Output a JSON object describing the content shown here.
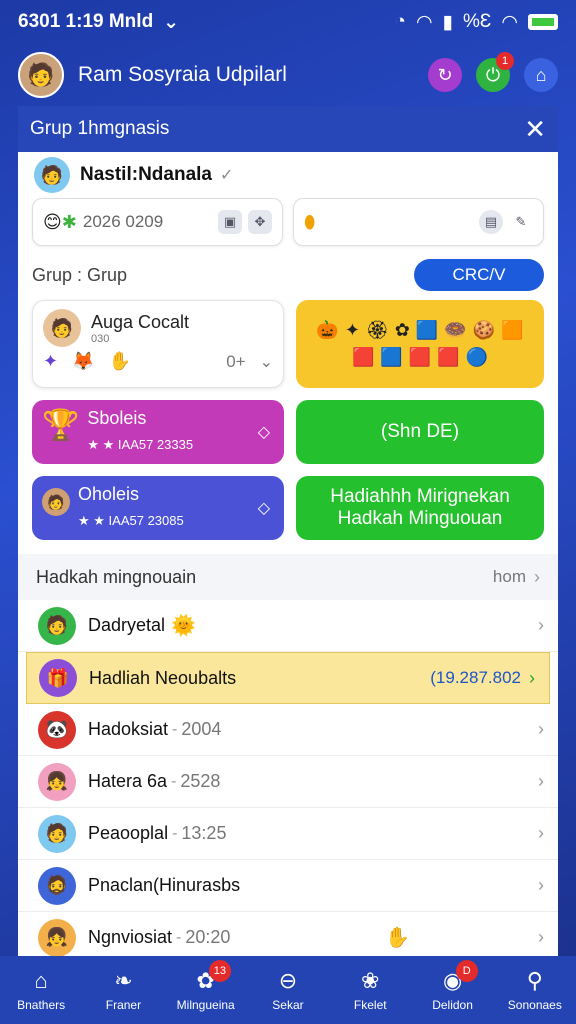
{
  "status": {
    "time": "6301 1:19 Mnld",
    "battery_text": "%Ɛ",
    "chevron": "chevron-down-icon"
  },
  "appbar": {
    "title": "Ram Sosyraia Udpilarl",
    "badge_green": "1"
  },
  "panel": {
    "title": "Grup 1hmgnasis",
    "close": "✕"
  },
  "profile": {
    "name": "Nastil:Ndanala"
  },
  "mini_cards": [
    {
      "date": "2026 0209"
    },
    {
      "date": ""
    }
  ],
  "group": {
    "label": "Grup : Grup",
    "button": "CRC/V"
  },
  "tiles": {
    "member": {
      "title": "Auga Cocalt",
      "sub": "030",
      "count": "0+"
    },
    "magenta": {
      "title": "Sboleis",
      "sub": "IAA57 23335"
    },
    "green1": {
      "title": "(Shn DE)"
    },
    "indigo": {
      "title": "Oholeis",
      "sub": "IAA57 23085"
    },
    "green2": {
      "line1": "Hadiahhh Mirignekan",
      "line2": "Hadkah Minguouan"
    }
  },
  "section": {
    "title": "Hadkah mingnouain",
    "more": "hom"
  },
  "list": [
    {
      "name": "Dadryetal",
      "value": ""
    },
    {
      "name": "Hadliah Neoubalts",
      "value": "(19.287.802"
    },
    {
      "name": "Hadoksiat",
      "value": "2004"
    },
    {
      "name": "Hatera 6a",
      "value": "2528"
    },
    {
      "name": "Peaooplal",
      "value": "13:25"
    },
    {
      "name": "Pnaclan(Hinurasbs",
      "value": ""
    },
    {
      "name": "Ngnviosiat",
      "value": "20:20"
    }
  ],
  "nav": [
    {
      "label": "Bnathers",
      "badge": ""
    },
    {
      "label": "Franer",
      "badge": ""
    },
    {
      "label": "Milngueina",
      "badge": "13"
    },
    {
      "label": "Sekar",
      "badge": ""
    },
    {
      "label": "Fkelet",
      "badge": ""
    },
    {
      "label": "Delidon",
      "badge": "D"
    },
    {
      "label": "Sononaes",
      "badge": ""
    }
  ],
  "colors": {
    "primary": "#2344b2",
    "accent": "#1b5bdc",
    "yellow": "#f6c62b",
    "magenta": "#c23ab8",
    "green": "#25c02d",
    "indigo": "#4b52d6",
    "highlight": "#fbe79c"
  }
}
